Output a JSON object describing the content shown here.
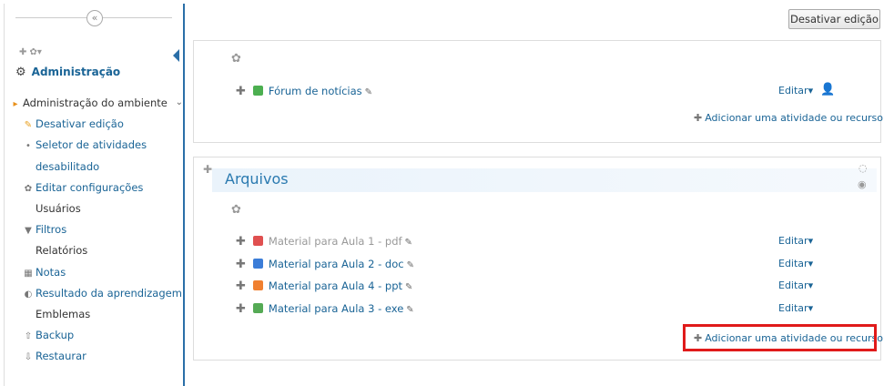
{
  "sidebar": {
    "collapse_symbol": "«",
    "tools": "✚ ✿▾",
    "block_title": "Administração",
    "items": [
      {
        "label": "Administração do ambiente",
        "icon": "triangle-orange-icon",
        "link": false,
        "chevron": true
      },
      {
        "label": "Desativar edição",
        "icon": "pencil-icon",
        "link": true,
        "chevron": false
      },
      {
        "label": "Seletor de atividades",
        "icon": "dot-icon",
        "link": true,
        "chevron": false
      },
      {
        "label": "desabilitado",
        "icon": "",
        "link": true,
        "chevron": false
      },
      {
        "label": "Editar configurações",
        "icon": "gear-icon",
        "link": true,
        "chevron": false
      },
      {
        "label": "Usuários",
        "icon": "",
        "link": false,
        "chevron": true
      },
      {
        "label": "Filtros",
        "icon": "filter-icon",
        "link": true,
        "chevron": false
      },
      {
        "label": "Relatórios",
        "icon": "",
        "link": false,
        "chevron": true
      },
      {
        "label": "Notas",
        "icon": "table-icon",
        "link": true,
        "chevron": false
      },
      {
        "label": "Resultado da aprendizagem",
        "icon": "palette-icon",
        "link": true,
        "chevron": false
      },
      {
        "label": "Emblemas",
        "icon": "",
        "link": false,
        "chevron": true
      },
      {
        "label": "Backup",
        "icon": "upload-icon",
        "link": true,
        "chevron": false
      },
      {
        "label": "Restaurar",
        "icon": "download-icon",
        "link": true,
        "chevron": false
      }
    ]
  },
  "header": {
    "edit_toggle_label": "Desativar edição"
  },
  "section1": {
    "activities": [
      {
        "label": "Fórum de notícias",
        "icon_color": "#4caf50"
      }
    ],
    "editar_label": "Editar▾",
    "add_label": "Adicionar uma atividade ou recurso"
  },
  "section2": {
    "title": "Arquivos",
    "activities": [
      {
        "label": "Material para Aula 1 - pdf",
        "icon_color": "#e05050",
        "dimmed": true
      },
      {
        "label": "Material para Aula 2 - doc",
        "icon_color": "#3b7dd8",
        "dimmed": false
      },
      {
        "label": "Material para Aula 4 - ppt",
        "icon_color": "#f08030",
        "dimmed": false
      },
      {
        "label": "Material para Aula 3 - exe",
        "icon_color": "#55aa55",
        "dimmed": false
      }
    ],
    "editar_label": "Editar▾",
    "add_label": "Adicionar uma atividade ou recurso"
  }
}
